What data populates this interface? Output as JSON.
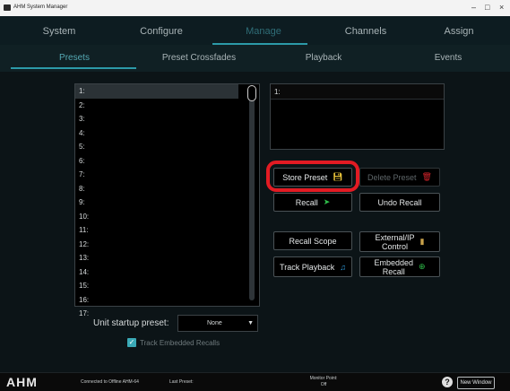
{
  "window": {
    "title": "AHM System Manager",
    "minimize": "–",
    "maximize": "□",
    "close": "×"
  },
  "main_nav": [
    {
      "label": "System"
    },
    {
      "label": "Configure"
    },
    {
      "label": "Manage",
      "active": true
    },
    {
      "label": "Channels"
    },
    {
      "label": "Assign"
    }
  ],
  "sub_nav": [
    {
      "label": "Presets",
      "active": true
    },
    {
      "label": "Preset Crossfades"
    },
    {
      "label": "Playback"
    },
    {
      "label": "Events"
    }
  ],
  "presets": [
    "1:",
    "2:",
    "3:",
    "4:",
    "5:",
    "6:",
    "7:",
    "8:",
    "9:",
    "10:",
    "11:",
    "12:",
    "13:",
    "14:",
    "15:",
    "16:",
    "17:"
  ],
  "preview": {
    "selected": "1:"
  },
  "buttons": {
    "store_preset": "Store Preset",
    "delete_preset": "Delete Preset",
    "recall": "Recall",
    "undo_recall": "Undo Recall",
    "recall_scope": "Recall Scope",
    "external_ip": "External/IP\nControl",
    "track_playback": "Track Playback",
    "embedded_recall": "Embedded\nRecall"
  },
  "startup": {
    "label": "Unit startup preset:",
    "value": "None"
  },
  "track_embedded": {
    "label": "Track Embedded Recalls",
    "checked": true
  },
  "status": {
    "logo": "AHM",
    "connection": "Connected to Offline AHM-64",
    "last_preset": "Last Preset:",
    "monitor_label": "Monitor Point:",
    "monitor_value": "Off",
    "help": "?",
    "new_window": "New Window"
  },
  "colors": {
    "accent": "#2c9aa8",
    "highlight": "#e21b23",
    "background": "#0c1417"
  }
}
